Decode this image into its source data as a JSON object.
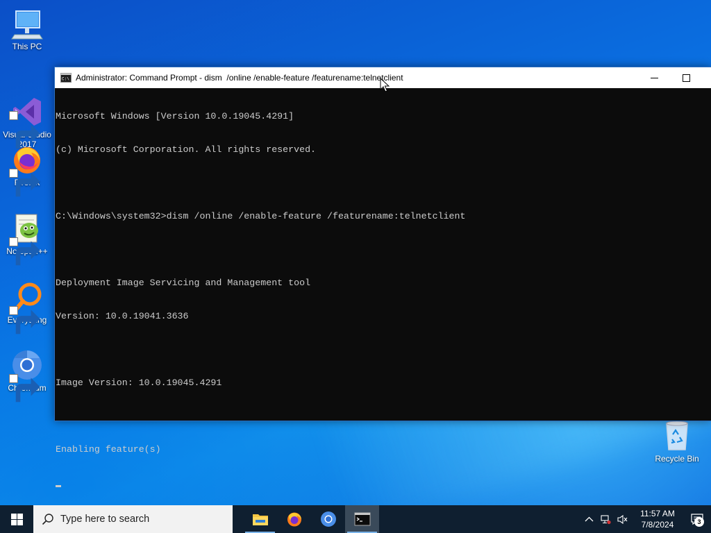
{
  "desktop": {
    "icons": [
      {
        "label": "This PC",
        "icon": "computer-icon"
      },
      {
        "label": "Visual Studio\n2017",
        "icon": "visual-studio-icon"
      },
      {
        "label": "Firefox",
        "icon": "firefox-icon"
      },
      {
        "label": "Notepad++",
        "icon": "notepadpp-icon"
      },
      {
        "label": "Everything",
        "icon": "everything-search-icon"
      },
      {
        "label": "Chromium",
        "icon": "chromium-icon"
      },
      {
        "label": "Recycle Bin",
        "icon": "recycle-bin-icon"
      }
    ]
  },
  "window": {
    "title": "Administrator: Command Prompt - dism  /online /enable-feature /featurename:telnetclient",
    "console_lines": [
      "Microsoft Windows [Version 10.0.19045.4291]",
      "(c) Microsoft Corporation. All rights reserved.",
      "",
      "C:\\Windows\\system32>dism /online /enable-feature /featurename:telnetclient",
      "",
      "Deployment Image Servicing and Management tool",
      "Version: 10.0.19041.3636",
      "",
      "Image Version: 10.0.19045.4291",
      "",
      "Enabling feature(s)"
    ]
  },
  "taskbar": {
    "search_placeholder": "Type here to search",
    "apps": [
      "file-explorer-icon",
      "firefox-icon",
      "chromium-icon",
      "command-prompt-icon"
    ],
    "time": "11:57 AM",
    "date": "7/8/2024",
    "notification_count": "3"
  },
  "colors": {
    "console_bg": "#0c0c0c",
    "console_text": "#cccccc",
    "taskbar_bg": "#0f1f30",
    "desktop_blue": "#0a6ee0"
  }
}
